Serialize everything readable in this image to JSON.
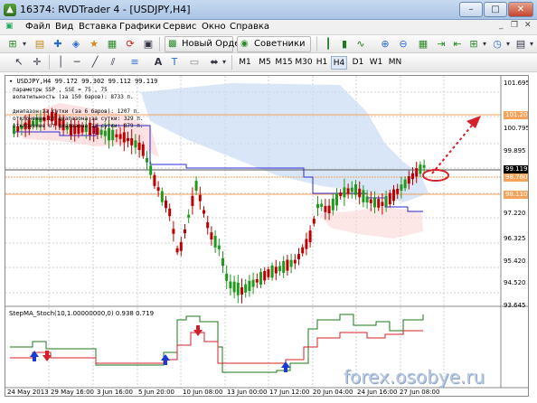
{
  "window": {
    "title": "16374: RVDTrader 4 - [USDJPY,H4]",
    "app_icon_glyph": "▲",
    "controls": {
      "minimize": "–",
      "maximize": "□",
      "close": "✕"
    }
  },
  "menu": {
    "items": [
      "Файл",
      "Вид",
      "Вставка",
      "Графики",
      "Сервис",
      "Окно",
      "Справка"
    ],
    "mdi_controls": {
      "minimize": "_",
      "restore": "❐",
      "close": "✕"
    }
  },
  "toolbar": {
    "new_order_label": "Новый Ордер",
    "advisors_label": "Советники",
    "timeframes": [
      "M1",
      "M5",
      "M15",
      "M30",
      "H1",
      "H4",
      "D1",
      "W1",
      "MN"
    ],
    "active_timeframe": "H4"
  },
  "chart": {
    "symbol_header": "USDJPY,H4  99.172 99.302 99.112 99.119",
    "overlay_lines": [
      "параметры  SSP , SSE =   75 ,  75",
      "волатильность  (за 150 баров):    8733  п.",
      "диапазон за сутки  (за  6  баров):   1207  п.",
      "отклонение  от  диапазона за сутки:  329  п.",
      "отклонение  от  диапазона за сутки:  879  п."
    ],
    "price_labels": [
      "101.695",
      "100.795",
      "99.895",
      "99.119",
      "98.095",
      "97.220",
      "96.325",
      "95.420",
      "94.520",
      "93.645"
    ],
    "tags": [
      {
        "text": "101.20",
        "color": "#f5a35a"
      },
      {
        "text": "99.119",
        "color": "#000000"
      },
      {
        "text": "98.760",
        "color": "#f5a35a"
      },
      {
        "text": "98.110",
        "color": "#f5a35a"
      }
    ],
    "time_labels": [
      "24 May 2013",
      "29 May 16:00",
      "3 Jun 16:00",
      "5 Jun 20:00",
      "10 Jun 08:00",
      "13 Jun 00:00",
      "17 Jun 12:00",
      "20 Jun 04:00",
      "24 Jun 16:00",
      "27 Jun 08:00"
    ]
  },
  "indicator": {
    "header": "StepMA_Stoch(10,1.00000000,0) 0.938 0.719"
  },
  "watermark": "forex.osobye.ru",
  "colors": {
    "bull_candle": "#1f9a1f",
    "bear_candle": "#c00000",
    "upper_line": "#2a2ad4",
    "support_line": "#f5a35a",
    "cloud_red": "#fbd6d6",
    "cloud_blue": "#c8dcf3",
    "forecast_arrow": "#d6202a",
    "indicator_green": "#1a7a1a",
    "indicator_red": "#d4202a"
  },
  "icons": [
    "app-icon",
    "new-chart-icon",
    "profiles-icon",
    "zoom-in-icon",
    "zoom-out-icon",
    "tile-icon",
    "autoscroll-icon",
    "crosshair-icon",
    "cursor-icon",
    "line-icon",
    "fibo-icon",
    "text-icon",
    "label-icon"
  ]
}
